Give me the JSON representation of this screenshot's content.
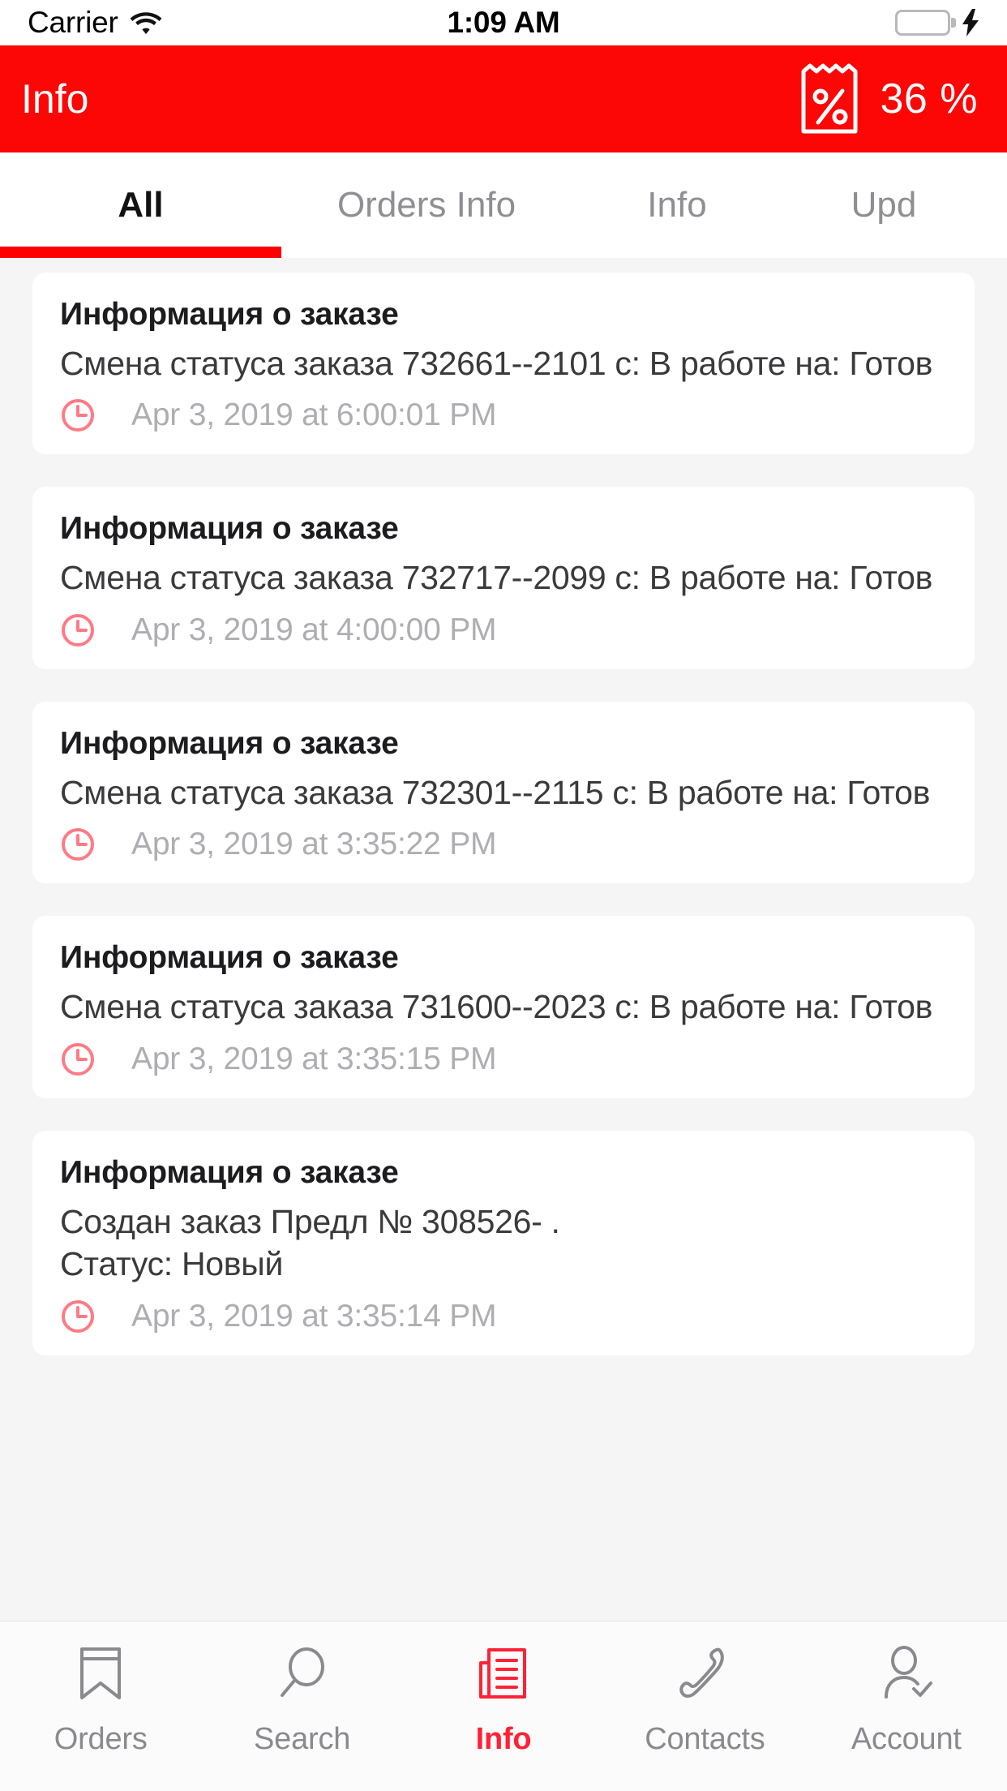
{
  "status_bar": {
    "carrier": "Carrier",
    "wifi_icon": "wifi-icon",
    "time": "1:09 AM",
    "battery_icon": "battery-full-icon",
    "battery_color": "#16da63",
    "charging_icon": "lightning-bolt-icon"
  },
  "navbar": {
    "title": "Info",
    "discount_icon": "receipt-percent-icon",
    "percent": "36 %",
    "background_color": "#fc0606",
    "text_color": "#ffffff"
  },
  "tabstrip": {
    "active_index": 0,
    "indicator_color": "#ff0000",
    "tabs": [
      {
        "label": "All"
      },
      {
        "label": "Orders Info"
      },
      {
        "label": "Info"
      },
      {
        "label": "Upd"
      }
    ]
  },
  "notifications": [
    {
      "title": "Информация о заказе",
      "body": "Смена статуса заказа 732661--2101 с: В работе на: Готов",
      "time_icon": "clock-icon",
      "time": "Apr 3, 2019 at 6:00:01 PM"
    },
    {
      "title": "Информация о заказе",
      "body": "Смена статуса заказа 732717--2099 с: В работе на: Готов",
      "time_icon": "clock-icon",
      "time": "Apr 3, 2019 at 4:00:00 PM"
    },
    {
      "title": "Информация о заказе",
      "body": "Смена статуса заказа 732301--2115 с: В работе на: Готов",
      "time_icon": "clock-icon",
      "time": "Apr 3, 2019 at 3:35:22 PM"
    },
    {
      "title": "Информация о заказе",
      "body": "Смена статуса заказа 731600--2023 с: В работе на: Готов",
      "time_icon": "clock-icon",
      "time": "Apr 3, 2019 at 3:35:15 PM"
    },
    {
      "title": "Информация о заказе",
      "body": "Создан заказ Предл № 308526-    .\nСтатус: Новый",
      "time_icon": "clock-icon",
      "time": "Apr 3, 2019 at 3:35:14 PM"
    }
  ],
  "tabbar": {
    "active_index": 2,
    "active_color": "#ff2236",
    "inactive_color": "#8a8a8e",
    "items": [
      {
        "label": "Orders",
        "icon": "bookmark-icon"
      },
      {
        "label": "Search",
        "icon": "search-icon"
      },
      {
        "label": "Info",
        "icon": "news-document-icon"
      },
      {
        "label": "Contacts",
        "icon": "phone-handset-icon"
      },
      {
        "label": "Account",
        "icon": "person-check-icon"
      }
    ]
  }
}
